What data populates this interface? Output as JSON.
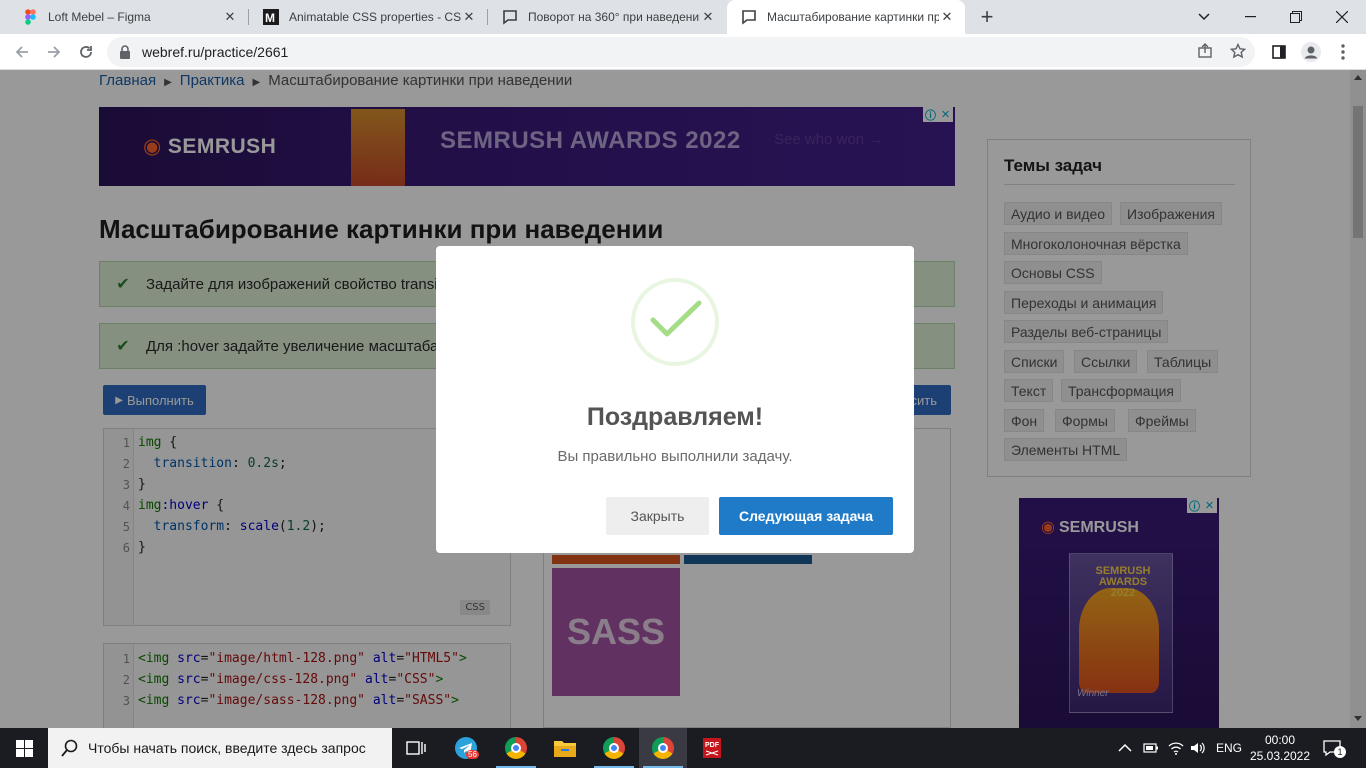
{
  "browser": {
    "tabs": [
      {
        "title": "Loft Mebel – Figma",
        "icon": "figma-icon",
        "active": false
      },
      {
        "title": "Animatable CSS properties - CSS",
        "icon": "mdn-icon",
        "active": false
      },
      {
        "title": "Поворот на 360° при наведении",
        "icon": "chat-icon",
        "active": false
      },
      {
        "title": "Масштабирование картинки пр",
        "icon": "chat-icon",
        "active": true
      }
    ],
    "new_tab_label": "+",
    "url": "webref.ru/practice/2661"
  },
  "page": {
    "breadcrumb": {
      "home": "Главная",
      "section": "Практика",
      "current": "Масштабирование картинки при наведении"
    },
    "banner": {
      "logo": "SEMRUSH",
      "headline": "SEMRUSH AWARDS 2022",
      "cta": "See who won →"
    },
    "title": "Масштабирование картинки при наведении",
    "tasks": [
      {
        "text": "Задайте для изображений свойство transition со значением 0.2s."
      },
      {
        "text": "Для :hover задайте увеличение масштаба картинки в 1.2 раза."
      }
    ],
    "run_button": "Выполнить",
    "reset_button": "Сбросить",
    "css_editor": {
      "lang_badge": "CSS",
      "lines": [
        {
          "n": "1",
          "code": "img {"
        },
        {
          "n": "2",
          "code": "  transition: 0.2s;"
        },
        {
          "n": "3",
          "code": "}"
        },
        {
          "n": "4",
          "code": "img:hover {"
        },
        {
          "n": "5",
          "code": "  transform: scale(1.2);"
        },
        {
          "n": "6",
          "code": "}"
        }
      ]
    },
    "html_editor": {
      "lines": [
        {
          "n": "1",
          "code": "<img src=\"image/html-128.png\" alt=\"HTML5\">"
        },
        {
          "n": "2",
          "code": "<img src=\"image/css-128.png\" alt=\"CSS\">"
        },
        {
          "n": "3",
          "code": "<img src=\"image/sass-128.png\" alt=\"SASS\">"
        }
      ]
    },
    "preview": {
      "sass_label": "SASS"
    },
    "sidebar": {
      "title": "Темы задач",
      "topics": [
        "Аудио и видео",
        "Изображения",
        "Многоколоночная вёрстка",
        "Основы CSS",
        "Переходы и анимация",
        "Разделы веб-страницы",
        "Списки",
        "Ссылки",
        "Таблицы",
        "Текст",
        "Трансформация",
        "Фон",
        "Формы",
        "Фреймы",
        "Элементы HTML"
      ]
    },
    "side_ad": {
      "logo": "SEMRUSH",
      "awards_line1": "SEMRUSH",
      "awards_line2": "AWARDS",
      "awards_line3": "2022",
      "winner": "Winner"
    }
  },
  "modal": {
    "title": "Поздравляем!",
    "text": "Вы правильно выполнили задачу.",
    "close_button": "Закрыть",
    "next_button": "Следующая задача",
    "success_color": "#a5dc86"
  },
  "taskbar": {
    "search_placeholder": "Чтобы начать поиск, введите здесь запрос",
    "telegram_badge": "56",
    "language": "ENG",
    "time": "00:00",
    "date": "25.03.2022",
    "notifications": "1"
  }
}
